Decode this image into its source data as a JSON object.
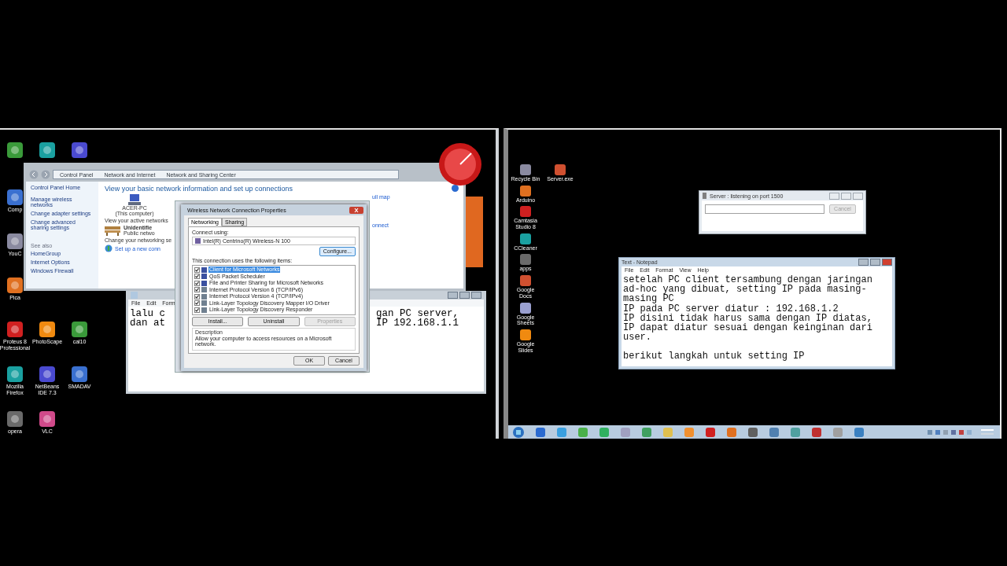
{
  "left_screen": {
    "desktop_icon_rows": [
      [
        {},
        {},
        {}
      ],
      [
        {
          "label": "Comp"
        }
      ],
      [
        {
          "label": "YouC"
        }
      ],
      [
        {
          "label": "Pica"
        }
      ],
      [
        {
          "label": "Proteus 8 Professional"
        },
        {
          "label": "PhotoScape"
        },
        {
          "label": "cal10"
        }
      ],
      [
        {
          "label": "Mozilla Firefox"
        },
        {
          "label": "NetBeans IDE 7.3"
        },
        {
          "label": "SMADAV"
        }
      ],
      [
        {
          "label": "opera"
        },
        {
          "label": "VLC"
        }
      ]
    ],
    "network_window": {
      "breadcrumb": [
        "Control Panel",
        "Network and Internet",
        "Network and Sharing Center"
      ],
      "sidebar_links": [
        "Control Panel Home",
        "Manage wireless networks",
        "Change adapter settings",
        "Change advanced sharing settings"
      ],
      "see_also_heading": "See also",
      "see_also_links": [
        "HomeGroup",
        "Internet Options",
        "Windows Firewall"
      ],
      "heading": "View your basic network information and set up connections",
      "computer_name": "ACER-PC",
      "computer_caption": "(This computer)",
      "active_networks_label": "View your active networks",
      "network_name": "Unidentifie",
      "network_type": "Public netwo",
      "change_settings_label": "Change your networking se",
      "setup_link": "Set up a new conn",
      "map_link": "ull map",
      "connect_link": "onnect"
    },
    "properties_dialog": {
      "title": "Wireless Network Connection Properties",
      "tabs": [
        {
          "label": "Networking",
          "selected": true
        },
        {
          "label": "Sharing",
          "selected": false
        }
      ],
      "connect_using_label": "Connect using:",
      "adapter": "Intel(R) Centrino(R) Wireless-N 100",
      "configure_button": "Configure...",
      "items_label": "This connection uses the following items:",
      "items": [
        {
          "label": "Client for Microsoft Networks",
          "checked": true,
          "selected": true
        },
        {
          "label": "QoS Packet Scheduler",
          "checked": true,
          "selected": false
        },
        {
          "label": "File and Printer Sharing for Microsoft Networks",
          "checked": true,
          "selected": false
        },
        {
          "label": "Internet Protocol Version 6 (TCP/IPv6)",
          "checked": true,
          "selected": false
        },
        {
          "label": "Internet Protocol Version 4 (TCP/IPv4)",
          "checked": true,
          "selected": false
        },
        {
          "label": "Link-Layer Topology Discovery Mapper I/O Driver",
          "checked": true,
          "selected": false
        },
        {
          "label": "Link-Layer Topology Discovery Responder",
          "checked": true,
          "selected": false
        }
      ],
      "item_buttons": [
        {
          "label": "Install...",
          "disabled": false
        },
        {
          "label": "Uninstall",
          "disabled": false
        },
        {
          "label": "Properties",
          "disabled": true
        }
      ],
      "description_label": "Description",
      "description": "Allow your computer to access resources on a Microsoft network.",
      "buttons": [
        "OK",
        "Cancel"
      ]
    },
    "notepad": {
      "menu": [
        "File",
        "Edit",
        "Form"
      ],
      "lines": [
        {
          "left": "lalu c",
          "right": "gan PC server,"
        },
        {
          "left": "dan at",
          "right": "IP 192.168.1.1"
        }
      ]
    }
  },
  "right_screen": {
    "desktop_icon_rows": [
      [
        {
          "label": "Recycle Bin"
        },
        {
          "label": "Server.exe"
        }
      ],
      [
        {
          "label": "Arduino"
        }
      ],
      [
        {
          "label": "Camtasia Studio 8"
        }
      ],
      [
        {
          "label": "CCleaner"
        }
      ],
      [
        {
          "label": "apps"
        }
      ],
      [
        {
          "label": "Google Docs"
        }
      ],
      [
        {
          "label": "Google Sheets"
        }
      ],
      [
        {
          "label": "Google Slides"
        }
      ]
    ],
    "server_window": {
      "title": "Server : listening on port 1500",
      "button": "Cancel"
    },
    "notepad": {
      "title": "Text - Notepad",
      "menu": [
        "File",
        "Edit",
        "Format",
        "View",
        "Help"
      ],
      "paragraphs": [
        [
          "setelah PC client tersambung dengan jaringan",
          "ad-hoc yang dibuat, setting IP pada masing-",
          "masing PC",
          "IP pada PC server diatur : 192.168.1.2",
          "IP disini tidak harus sama dengan IP diatas,",
          "IP dapat diatur sesuai dengan keinginan dari",
          "user."
        ],
        [
          "berikut langkah untuk setting IP"
        ]
      ]
    }
  }
}
